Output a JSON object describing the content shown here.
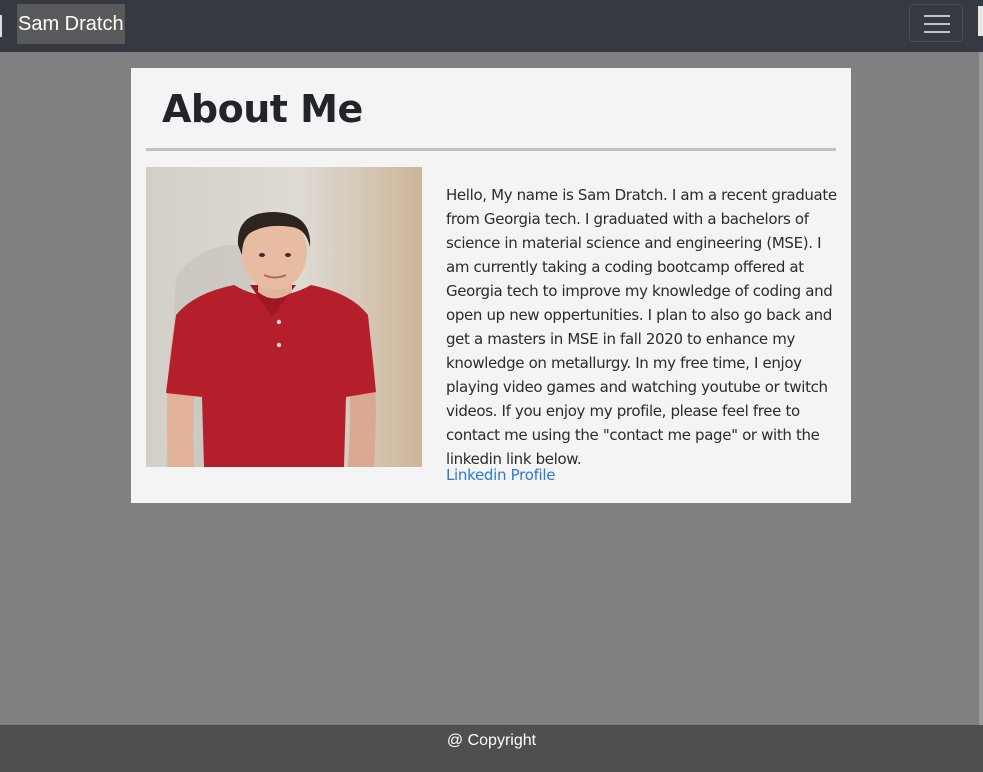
{
  "navbar": {
    "brand": "Sam Dratch",
    "toggle_icon": "hamburger-menu-icon"
  },
  "about": {
    "title": "About Me",
    "photo_alt": "Photo of Sam Dratch",
    "bio": "Hello, My name is Sam Dratch. I am a recent graduate from Georgia tech. I graduated with a bachelors of science in material science and engineering (MSE). I am currently taking a coding bootcamp offered at Georgia tech to improve my knowledge of coding and open up new oppertunities. I plan to also go back and get a masters in MSE in fall 2020 to enhance my knowledge on metallurgy. In my free time, I enjoy playing video games and watching youtube or twitch videos. If you enjoy my profile, please feel free to contact me using the \"contact me page\" or with the linkedin link below.",
    "link_label": "Linkedin Profile"
  },
  "footer": {
    "text": "@ Copyright"
  },
  "colors": {
    "navbar": "#343a40",
    "page_background": "#808080",
    "card_background": "#f4f4f4",
    "link": "#2a7ad6",
    "footer": "#4f4f4f"
  }
}
